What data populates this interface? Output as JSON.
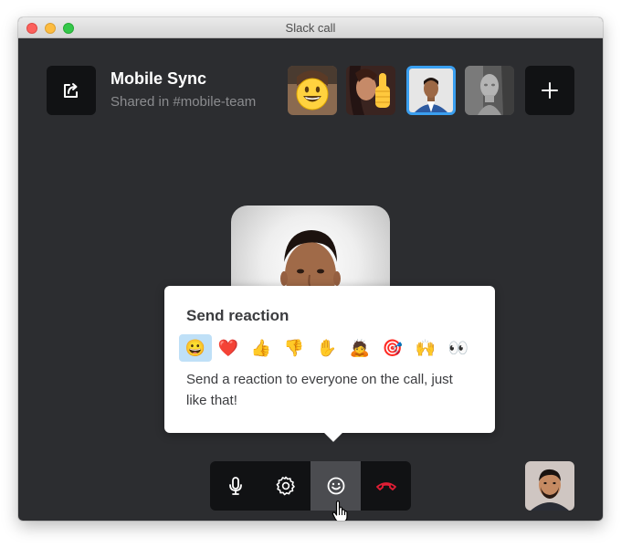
{
  "window": {
    "title": "Slack call"
  },
  "call": {
    "name": "Mobile Sync",
    "shared_in": "Shared in #mobile-team"
  },
  "participants": [
    {
      "id": "participant-1",
      "avatar": "grinning-emoji-over-photo"
    },
    {
      "id": "participant-2",
      "avatar": "thumbs-up-emoji-over-photo"
    },
    {
      "id": "participant-3",
      "avatar": "man-photo",
      "active": true
    },
    {
      "id": "participant-4",
      "avatar": "statue-photo"
    }
  ],
  "reaction_popup": {
    "title": "Send reaction",
    "description": "Send a reaction to everyone on the call, just like that!",
    "emojis": [
      {
        "name": "grinning-face",
        "glyph": "😀",
        "selected": true
      },
      {
        "name": "red-heart",
        "glyph": "❤️"
      },
      {
        "name": "thumbs-up",
        "glyph": "👍"
      },
      {
        "name": "thumbs-down",
        "glyph": "👎"
      },
      {
        "name": "raised-hand",
        "glyph": "✋"
      },
      {
        "name": "person-bowing",
        "glyph": "🙇"
      },
      {
        "name": "direct-hit",
        "glyph": "🎯"
      },
      {
        "name": "raising-hands",
        "glyph": "🙌"
      },
      {
        "name": "eyes",
        "glyph": "👀"
      }
    ]
  },
  "controls": [
    {
      "name": "microphone",
      "icon": "microphone-icon"
    },
    {
      "name": "settings",
      "icon": "gear-icon"
    },
    {
      "name": "reactions",
      "icon": "smiley-icon",
      "active": true
    },
    {
      "name": "hang-up",
      "icon": "phone-hangup-icon"
    }
  ],
  "colors": {
    "window_bg": "#2c2d30",
    "button_bg": "#111214",
    "active_outline": "#3a9ff0",
    "hangup": "#e01e35",
    "emoji_highlight": "#bfe0f7"
  }
}
